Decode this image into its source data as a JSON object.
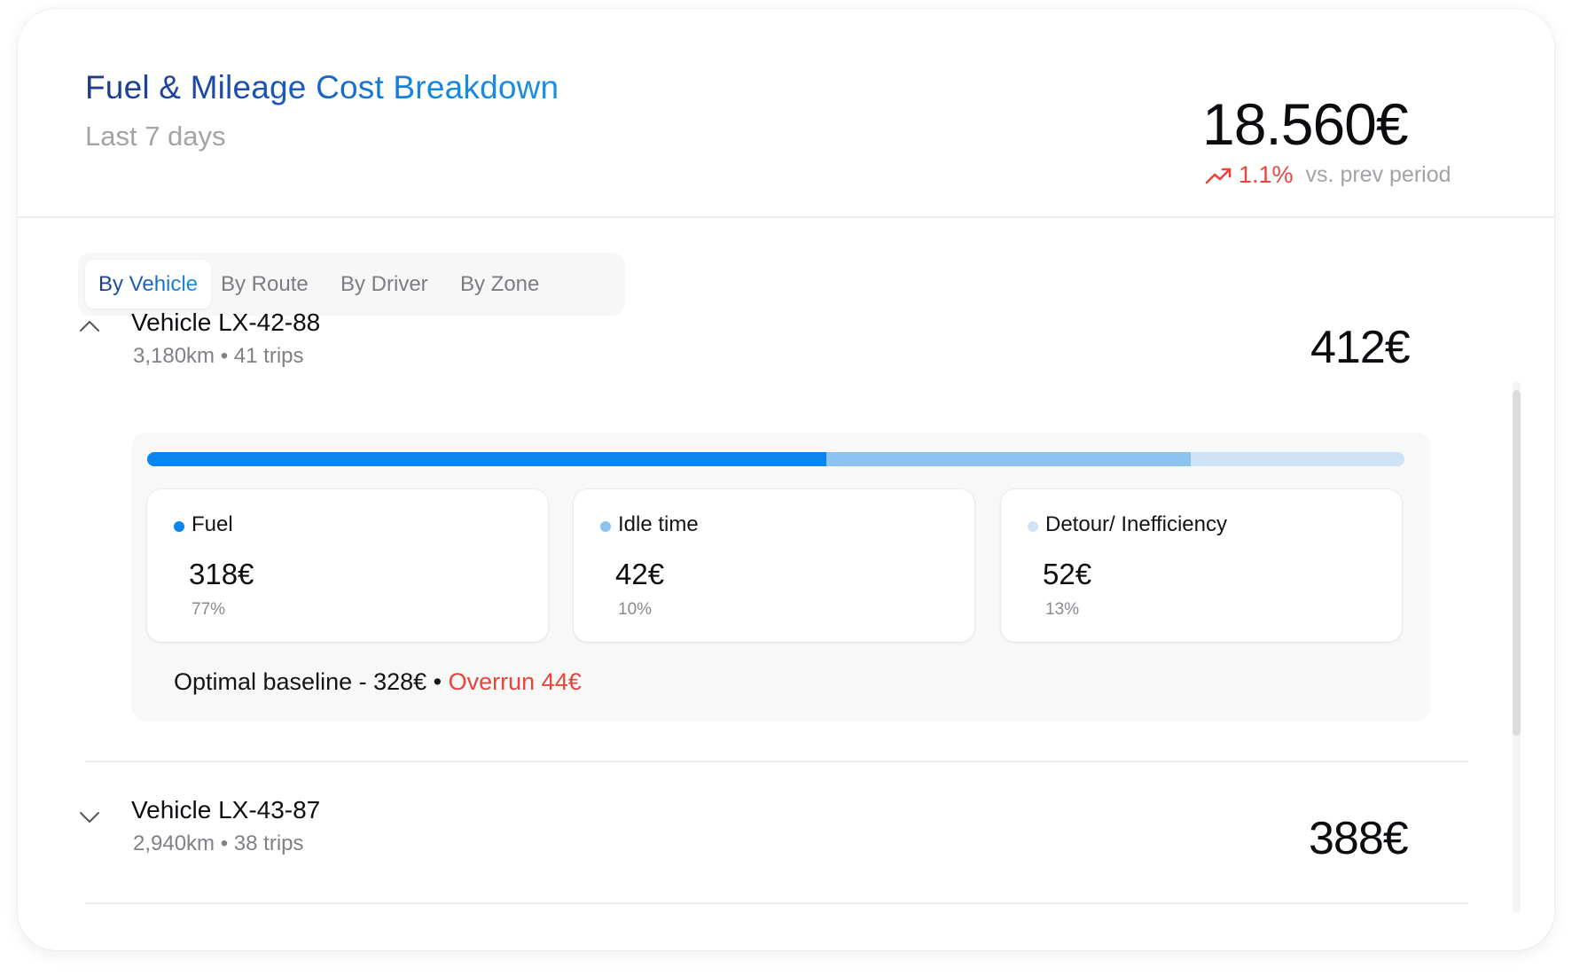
{
  "header": {
    "title": "Fuel & Mileage Cost Breakdown",
    "subtitle": "Last 7 days",
    "total": "18.560€",
    "trend_pct": "1.1%",
    "trend_text": "vs. prev period",
    "trend_icon": "trending-up-icon",
    "trend_color": "#e8453c"
  },
  "tabs": [
    {
      "label": "By Vehicle",
      "active": true
    },
    {
      "label": "By Route",
      "active": false
    },
    {
      "label": "By Driver",
      "active": false
    },
    {
      "label": "By Zone",
      "active": false
    }
  ],
  "vehicles": [
    {
      "name": "Vehicle LX-42-88",
      "meta": "3,180km • 41 trips",
      "amount": "412€",
      "expanded": true,
      "breakdown": [
        {
          "label": "Fuel",
          "value": "318€",
          "pct": "77%",
          "share": 0.54,
          "color": "#0a84ee"
        },
        {
          "label": "Idle time",
          "value": "42€",
          "pct": "10%",
          "share": 0.29,
          "color": "#8cc3f0"
        },
        {
          "label": "Detour/ Inefficiency",
          "value": "52€",
          "pct": "13%",
          "share": 0.17,
          "color": "#cfe3f6"
        }
      ],
      "baseline_text": "Optimal baseline - 328€ •",
      "overrun_text": "Overrun 44€"
    },
    {
      "name": "Vehicle LX-43-87",
      "meta": "2,940km • 38 trips",
      "amount": "388€",
      "expanded": false
    }
  ],
  "colors": {
    "accent": "#1a8fe8",
    "accent_dark": "#1e3a8a",
    "negative": "#e8453c"
  }
}
